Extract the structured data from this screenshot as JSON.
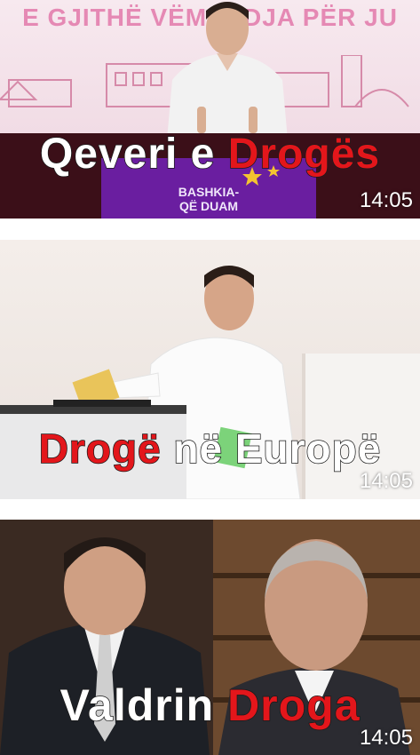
{
  "thumbnails": [
    {
      "banner_text": "E GJITHË VËMENDJA PËR JU",
      "podium_text": "BASHKIA-\nQË DUAM",
      "caption_parts": [
        {
          "text": "Qeveri e ",
          "color": "#ffffff"
        },
        {
          "text": "Drogës",
          "color": "#e3161b"
        }
      ],
      "duration": "14:05"
    },
    {
      "caption_parts": [
        {
          "text": "Drogë ",
          "color": "#e3161b"
        },
        {
          "text": "në Europë",
          "color": "#ffffff"
        }
      ],
      "duration": "14:05"
    },
    {
      "caption_parts": [
        {
          "text": "Valdrin ",
          "color": "#ffffff"
        },
        {
          "text": "Droga",
          "color": "#e3161b"
        }
      ],
      "duration": "14:05"
    }
  ]
}
